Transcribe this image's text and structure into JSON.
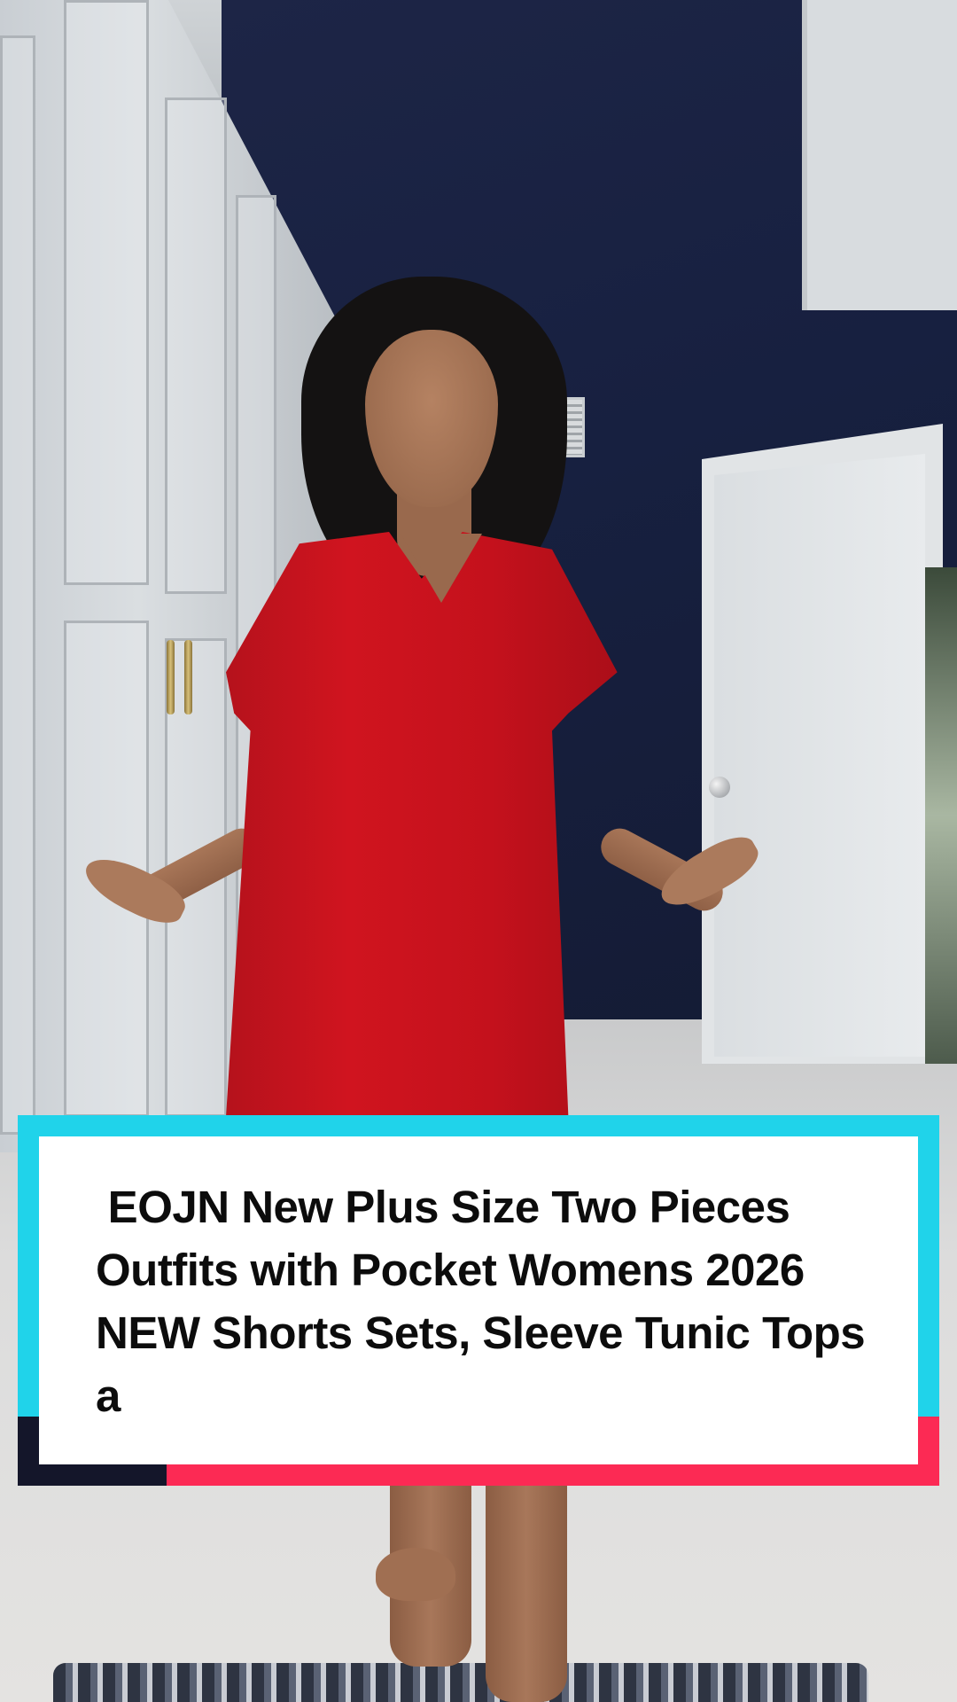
{
  "caption": {
    "text": " EOJN New Plus Size Two Pieces Outfits with Pocket Womens 2026 NEW Shorts Sets, Sleeve Tunic Tops a"
  },
  "colors": {
    "card_cyan": "#20d3ea",
    "card_red": "#fc2a54",
    "card_navy": "#14162a",
    "card_white": "#ffffff",
    "dress_red": "#c4111c",
    "wall_navy": "#172040"
  }
}
